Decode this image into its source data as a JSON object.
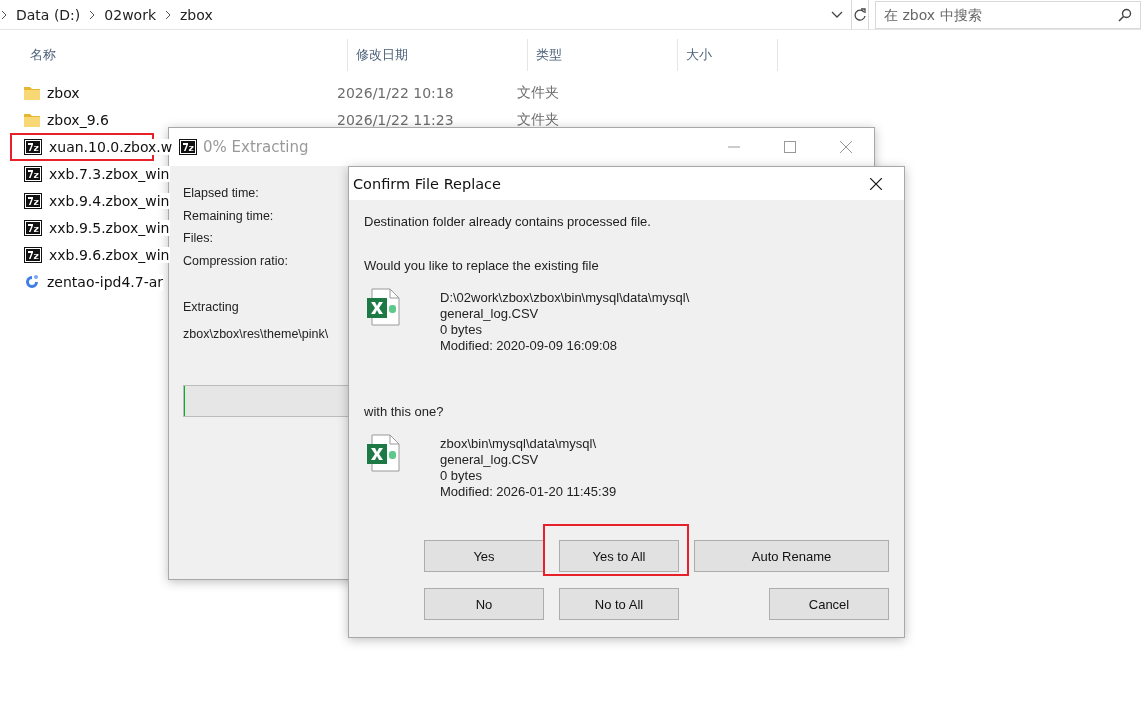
{
  "explorer": {
    "breadcrumb": [
      "Data (D:)",
      "02work",
      "zbox"
    ],
    "search": {
      "placeholder": "在 zbox 中搜索"
    },
    "columns": [
      "名称",
      "修改日期",
      "类型",
      "大小"
    ],
    "rows": [
      {
        "kind": "folder",
        "name": "zbox",
        "date": "2026/1/22 10:18",
        "type": "文件夹",
        "highlighted": false
      },
      {
        "kind": "folder",
        "name": "zbox_9.6",
        "date": "2026/1/22 11:23",
        "type": "文件夹",
        "highlighted": false
      },
      {
        "kind": "archive",
        "name": "xuan.10.0.zbox.w",
        "highlighted": true
      },
      {
        "kind": "archive",
        "name": "xxb.7.3.zbox_win",
        "highlighted": false
      },
      {
        "kind": "archive",
        "name": "xxb.9.4.zbox_win",
        "highlighted": false
      },
      {
        "kind": "archive",
        "name": "xxb.9.5.zbox_win",
        "highlighted": false
      },
      {
        "kind": "archive",
        "name": "xxb.9.6.zbox_win",
        "highlighted": false
      },
      {
        "kind": "swirl",
        "name": "zentao-ipd4.7-ar",
        "highlighted": false
      }
    ]
  },
  "progress_window": {
    "title": "0% Extracting",
    "labels": [
      "Elapsed time:",
      "Remaining time:",
      "Files:",
      "Compression ratio:"
    ],
    "action": "Extracting",
    "path": "zbox\\zbox\\res\\theme\\pink\\",
    "level": 0
  },
  "confirm_dialog": {
    "title": "Confirm File Replace",
    "message": "Destination folder already contains processed file.",
    "question": "Would you like to replace the existing file",
    "existing": [
      "D:\\02work\\zbox\\zbox\\bin\\mysql\\data\\mysql\\",
      "general_log.CSV",
      "0 bytes",
      "Modified: 2020-09-09 16:09:08"
    ],
    "with_label": "with this one?",
    "incoming": [
      "zbox\\bin\\mysql\\data\\mysql\\",
      "general_log.CSV",
      "0 bytes",
      "Modified: 2026-01-20 11:45:39"
    ],
    "buttons": [
      [
        {
          "label": "Yes",
          "highlighted": false
        },
        {
          "label": "Yes to All",
          "highlighted": true
        },
        {
          "label": "Auto Rename",
          "highlighted": false
        }
      ],
      [
        {
          "label": "No",
          "highlighted": false
        },
        {
          "label": "No to All",
          "highlighted": false
        },
        {
          "label": "Cancel",
          "highlighted": false
        }
      ]
    ]
  }
}
